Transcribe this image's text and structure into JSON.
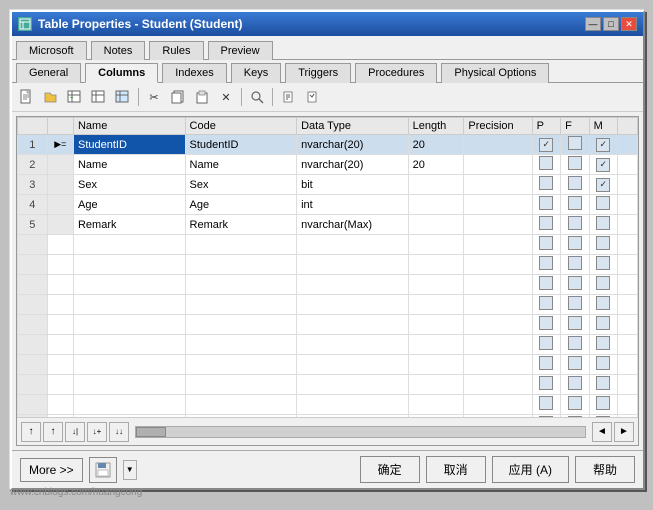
{
  "window": {
    "title": "Table Properties - Student (Student)",
    "icon": "table-icon"
  },
  "title_buttons": {
    "minimize": "—",
    "maximize": "□",
    "close": "✕"
  },
  "tab_rows": {
    "top": [
      {
        "id": "microsoft",
        "label": "Microsoft",
        "active": false
      },
      {
        "id": "notes",
        "label": "Notes",
        "active": false
      },
      {
        "id": "rules",
        "label": "Rules",
        "active": false
      },
      {
        "id": "preview",
        "label": "Preview",
        "active": false
      }
    ],
    "bottom": [
      {
        "id": "general",
        "label": "General",
        "active": false
      },
      {
        "id": "columns",
        "label": "Columns",
        "active": true
      },
      {
        "id": "indexes",
        "label": "Indexes",
        "active": false
      },
      {
        "id": "keys",
        "label": "Keys",
        "active": false
      },
      {
        "id": "triggers",
        "label": "Triggers",
        "active": false
      },
      {
        "id": "procedures",
        "label": "Procedures",
        "active": false
      },
      {
        "id": "physical_options",
        "label": "Physical Options",
        "active": false
      }
    ]
  },
  "toolbar": {
    "buttons": [
      {
        "id": "new",
        "icon": "📄",
        "tooltip": "New"
      },
      {
        "id": "open",
        "icon": "📂",
        "tooltip": "Open"
      },
      {
        "id": "table1",
        "icon": "⊞",
        "tooltip": "Table1"
      },
      {
        "id": "table2",
        "icon": "⊟",
        "tooltip": "Table2"
      },
      {
        "id": "copy",
        "icon": "⧉",
        "tooltip": "Copy"
      },
      {
        "id": "cut",
        "icon": "✂",
        "tooltip": "Cut"
      },
      {
        "id": "paste",
        "icon": "📋",
        "tooltip": "Paste"
      },
      {
        "id": "delete",
        "icon": "✕",
        "tooltip": "Delete"
      },
      {
        "id": "find",
        "icon": "🔍",
        "tooltip": "Find"
      },
      {
        "id": "prop1",
        "icon": "⚙",
        "tooltip": "Properties"
      },
      {
        "id": "prop2",
        "icon": "⚙",
        "tooltip": "Properties2"
      }
    ]
  },
  "table": {
    "headers": [
      "",
      "",
      "Name",
      "Code",
      "Data Type",
      "Length",
      "Precision",
      "P",
      "F",
      "M"
    ],
    "rows": [
      {
        "num": 1,
        "indicator": "▶=",
        "name": "StudentID",
        "code": "StudentID",
        "data_type": "nvarchar(20)",
        "length": "20",
        "precision": "",
        "p": true,
        "f": false,
        "m": true,
        "selected": true
      },
      {
        "num": 2,
        "indicator": "",
        "name": "Name",
        "code": "Name",
        "data_type": "nvarchar(20)",
        "length": "20",
        "precision": "",
        "p": false,
        "f": false,
        "m": true,
        "selected": false
      },
      {
        "num": 3,
        "indicator": "",
        "name": "Sex",
        "code": "Sex",
        "data_type": "bit",
        "length": "",
        "precision": "",
        "p": false,
        "f": false,
        "m": true,
        "selected": false
      },
      {
        "num": 4,
        "indicator": "",
        "name": "Age",
        "code": "Age",
        "data_type": "int",
        "length": "",
        "precision": "",
        "p": false,
        "f": false,
        "m": false,
        "selected": false
      },
      {
        "num": 5,
        "indicator": "",
        "name": "Remark",
        "code": "Remark",
        "data_type": "nvarchar(Max)",
        "length": "",
        "precision": "",
        "p": false,
        "f": false,
        "m": false,
        "selected": false
      }
    ],
    "empty_rows": 12
  },
  "bottom_nav": {
    "buttons": [
      "↑",
      "↓",
      "↓|",
      "↓+",
      "↓↓"
    ]
  },
  "footer": {
    "more_label": "More >>",
    "save_icon": "💾",
    "confirm_label": "确定",
    "cancel_label": "取消",
    "apply_label": "应用 (A)",
    "help_label": "帮助"
  },
  "watermark": "www.cnblogs.com/huangcong"
}
